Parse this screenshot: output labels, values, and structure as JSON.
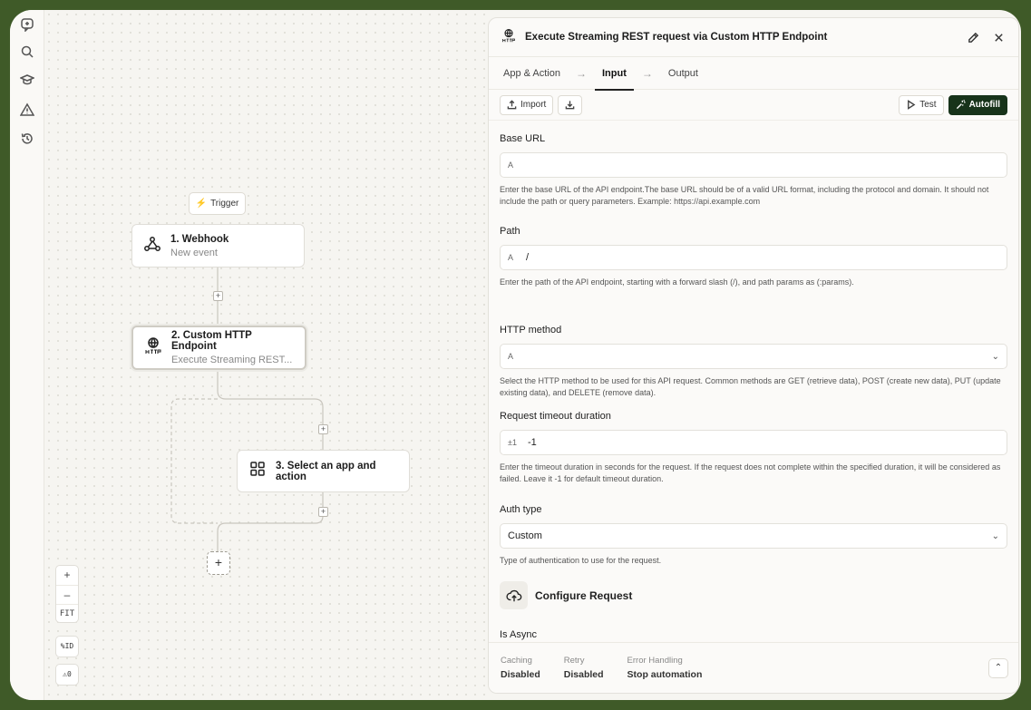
{
  "rail": {
    "icons": [
      "bot-chat-icon",
      "search-icon",
      "graduation-cap-icon",
      "warning-icon",
      "history-icon"
    ]
  },
  "canvas": {
    "trigger_label": "Trigger",
    "nodes": [
      {
        "title": "1. Webhook",
        "subtitle": "New event"
      },
      {
        "title": "2. Custom HTTP Endpoint",
        "subtitle": "Execute Streaming REST..."
      },
      {
        "title": "3. Select an app and action",
        "subtitle": ""
      }
    ],
    "add_symbol": "+",
    "zoom": {
      "in": "+",
      "out": "–",
      "fit": "FIT"
    },
    "id_toggle": "ID",
    "warnings_count": "0"
  },
  "panel": {
    "title": "Execute Streaming REST request via Custom HTTP Endpoint",
    "tabs": [
      "App & Action",
      "Input",
      "Output"
    ],
    "active_tab": "Input",
    "toolbar": {
      "import_label": "Import",
      "test_label": "Test",
      "autofill_label": "Autofill"
    },
    "fields": [
      {
        "label": "Base URL",
        "icon": "A",
        "value": "",
        "help": "Enter the base URL of the API endpoint.The base URL should be of a valid URL format, including the protocol and domain. It should not include the path or query parameters. Example: https://api.example.com"
      },
      {
        "label": "Path",
        "icon": "A",
        "value": "/",
        "help": "Enter the path of the API endpoint, starting with a forward slash (/), and path params as (:params)."
      },
      {
        "label": "HTTP method",
        "icon": "A",
        "value": "",
        "help": "Select the HTTP method to be used for this API request. Common methods are GET (retrieve data), POST (create new data), PUT (update existing data), and DELETE (remove data)."
      },
      {
        "label": "Request timeout duration",
        "icon": "±1",
        "value": "-1",
        "help": "Enter the timeout duration in seconds for the request. If the request does not complete within the specified duration, it will be considered as failed. Leave it -1 for default timeout duration."
      },
      {
        "label": "Auth type",
        "icon": "",
        "value": "Custom",
        "help": "Type of authentication to use for the request."
      }
    ],
    "configure_label": "Configure Request",
    "is_async_label": "Is Async",
    "footer": [
      {
        "key": "Caching",
        "value": "Disabled"
      },
      {
        "key": "Retry",
        "value": "Disabled"
      },
      {
        "key": "Error Handling",
        "value": "Stop automation"
      }
    ]
  },
  "colors": {
    "accent": "#17331a",
    "frame_border": "#3f5a28"
  }
}
